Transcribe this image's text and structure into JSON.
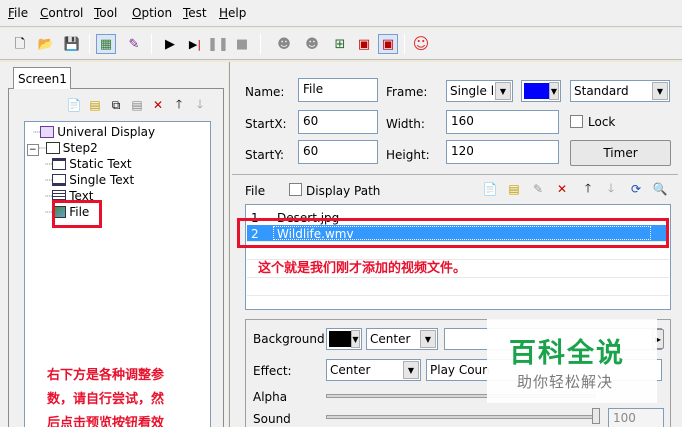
{
  "menu": [
    "File",
    "Control",
    "Tool",
    "Option",
    "Test",
    "Help"
  ],
  "menu_underline": [
    "F",
    "C",
    "T",
    "O",
    "T",
    "H"
  ],
  "toolbar_icons": [
    "new-file-icon",
    "open-folder-icon",
    "save-icon",
    "grid-icon",
    "edit-icon",
    "play-icon",
    "step-play-icon",
    "pause-icon",
    "stop-icon",
    "user-icon",
    "user2-icon",
    "network-icon",
    "screen-icon",
    "screen2-icon",
    "smiley-icon"
  ],
  "left": {
    "tab": "Screen1",
    "tree": [
      {
        "label": "Univeral Display",
        "level": 0
      },
      {
        "label": "Step2",
        "level": 0
      },
      {
        "label": "Static Text",
        "level": 1
      },
      {
        "label": "Single Text",
        "level": 1
      },
      {
        "label": "Text",
        "level": 1
      },
      {
        "label": "File",
        "level": 1
      }
    ],
    "annotation_lines": [
      "右下方是各种调整参",
      "数，请自行尝试，然",
      "后点击预览按钮看效"
    ]
  },
  "props": {
    "name_label": "Name:",
    "name_value": "File",
    "frame_label": "Frame:",
    "frame_value": "Single li",
    "frame_color": "#0000ff",
    "style_value": "Standard",
    "startx_label": "StartX:",
    "startx_value": "60",
    "width_label": "Width:",
    "width_value": "160",
    "lock_label": "Lock",
    "starty_label": "StartY:",
    "starty_value": "60",
    "height_label": "Height:",
    "height_value": "120",
    "timer_label": "Timer"
  },
  "file": {
    "label": "File",
    "display_path_label": "Display Path",
    "rows": [
      {
        "num": "1",
        "name": "Desert.jpg"
      },
      {
        "num": "2",
        "name": "Wildlife.wmv"
      }
    ],
    "annotation": "这个就是我们刚才添加的视频文件。"
  },
  "bottom": {
    "background_label": "Background:",
    "background_color": "#000000",
    "background_align": "Center",
    "effect_label": "Effect:",
    "effect_value": "Center",
    "playcount_value": "Play Coun",
    "alpha_label": "Alpha",
    "sound_label": "Sound",
    "sound_value": "100"
  },
  "watermark": {
    "title": "百科全说",
    "subtitle": "助你轻松解决"
  },
  "colors": {
    "annotation_red": "#e8112d",
    "selection_blue": "#3399ff",
    "watermark_green": "#1aa34a"
  }
}
